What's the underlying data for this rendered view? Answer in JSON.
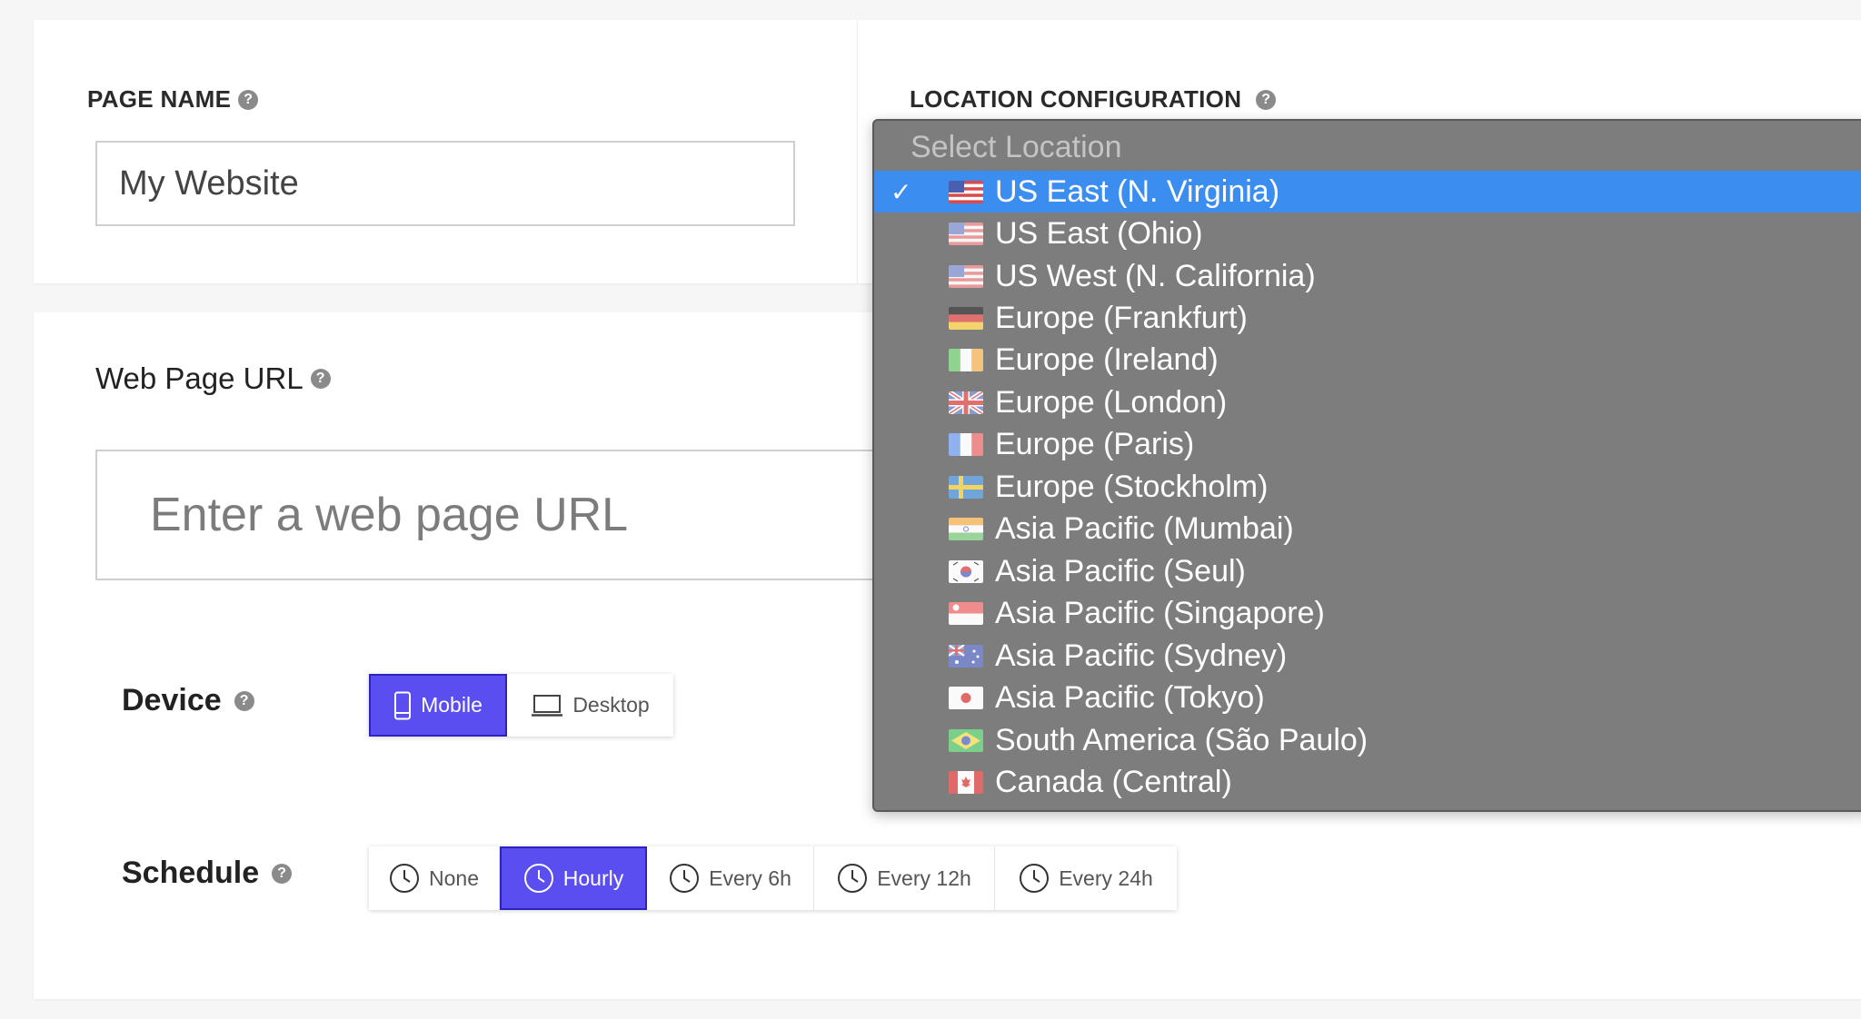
{
  "page_name": {
    "label": "PAGE NAME",
    "help": "?",
    "value": "My Website"
  },
  "location": {
    "label": "LOCATION CONFIGURATION",
    "help": "?",
    "placeholder": "Select Location",
    "options": [
      {
        "label": "US East (N. Virginia)",
        "flag": "us-flag",
        "selected": true
      },
      {
        "label": "US East (Ohio)",
        "flag": "us-flag"
      },
      {
        "label": "US West (N. California)",
        "flag": "us-flag"
      },
      {
        "label": "Europe (Frankfurt)",
        "flag": "de-flag"
      },
      {
        "label": "Europe (Ireland)",
        "flag": "ie-flag"
      },
      {
        "label": "Europe (London)",
        "flag": "gb-flag"
      },
      {
        "label": "Europe (Paris)",
        "flag": "fr-flag"
      },
      {
        "label": "Europe (Stockholm)",
        "flag": "se-flag"
      },
      {
        "label": "Asia Pacific (Mumbai)",
        "flag": "in-flag"
      },
      {
        "label": "Asia Pacific (Seul)",
        "flag": "kr-flag"
      },
      {
        "label": "Asia Pacific (Singapore)",
        "flag": "sg-flag"
      },
      {
        "label": "Asia Pacific (Sydney)",
        "flag": "au-flag"
      },
      {
        "label": "Asia Pacific (Tokyo)",
        "flag": "jp-flag"
      },
      {
        "label": "South America (São Paulo)",
        "flag": "br-flag"
      },
      {
        "label": "Canada (Central)",
        "flag": "ca-flag"
      }
    ]
  },
  "url": {
    "label": "Web Page URL",
    "help": "?",
    "placeholder": "Enter a web page URL"
  },
  "device": {
    "label": "Device",
    "help": "?",
    "options": [
      {
        "label": "Mobile",
        "icon": "mobile-icon",
        "active": true
      },
      {
        "label": "Desktop",
        "icon": "laptop-icon",
        "active": false
      }
    ]
  },
  "schedule": {
    "label": "Schedule",
    "help": "?",
    "options": [
      {
        "label": "None",
        "icon": "clock-icon",
        "active": false
      },
      {
        "label": "Hourly",
        "icon": "clock-icon",
        "active": true
      },
      {
        "label": "Every 6h",
        "icon": "clock-icon",
        "active": false
      },
      {
        "label": "Every 12h",
        "icon": "clock-icon",
        "active": false
      },
      {
        "label": "Every 24h",
        "icon": "clock-icon",
        "active": false
      }
    ]
  },
  "colors": {
    "accent": "#5b4ef0",
    "dropdown_bg": "#7d7d7d",
    "dropdown_selected": "#3b8ef0"
  }
}
